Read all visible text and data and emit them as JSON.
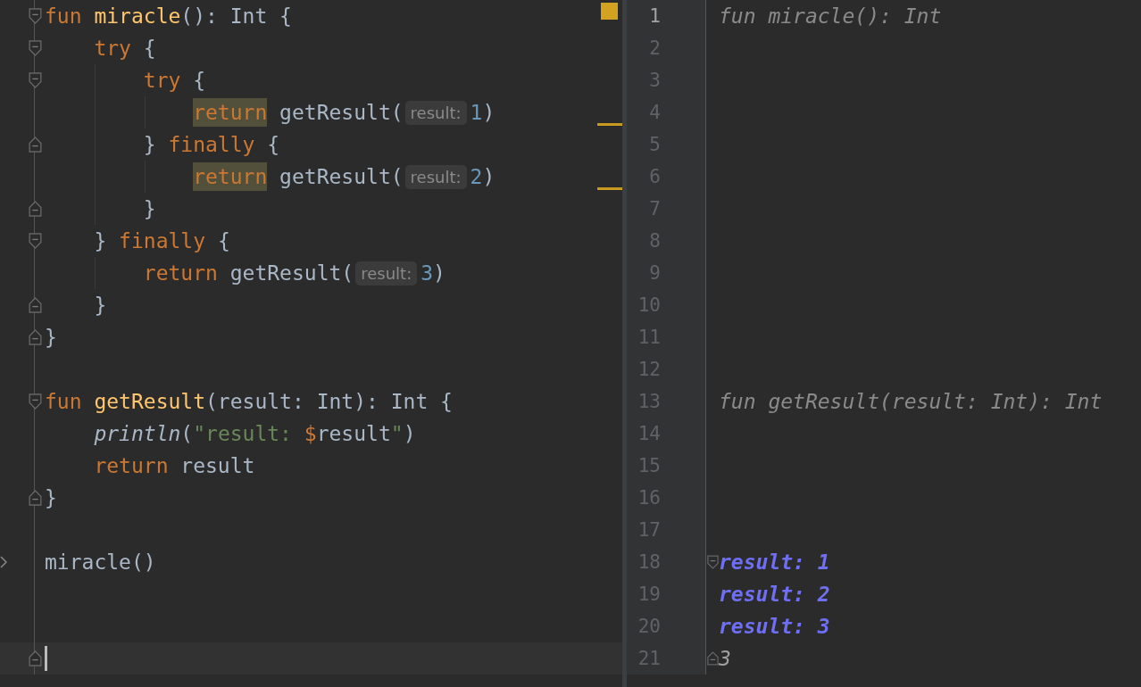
{
  "editor": {
    "lines": [
      {
        "fold_open": true,
        "fold_close": false,
        "current": false,
        "run_marker": false,
        "tokens": [
          {
            "kind": "keyword",
            "text": "fun "
          },
          {
            "kind": "decl",
            "text": "miracle"
          },
          {
            "kind": "plain",
            "text": "(): Int {"
          }
        ]
      },
      {
        "fold_open": true,
        "fold_close": false,
        "current": false,
        "run_marker": false,
        "tokens": [
          {
            "kind": "keyword",
            "text": "    try "
          },
          {
            "kind": "plain",
            "text": "{"
          }
        ]
      },
      {
        "fold_open": true,
        "fold_close": false,
        "current": false,
        "run_marker": false,
        "tokens": [
          {
            "kind": "keyword",
            "text": "        try "
          },
          {
            "kind": "plain",
            "text": "{"
          }
        ]
      },
      {
        "fold_open": false,
        "fold_close": false,
        "current": false,
        "run_marker": false,
        "tokens": [
          {
            "kind": "match",
            "text": "            return"
          },
          {
            "kind": "plain",
            "text": " getResult("
          },
          {
            "kind": "hint",
            "text": "result:"
          },
          {
            "kind": "number",
            "text": "1"
          },
          {
            "kind": "plain",
            "text": ")"
          }
        ]
      },
      {
        "fold_open": false,
        "fold_close": true,
        "current": false,
        "run_marker": false,
        "tokens": [
          {
            "kind": "plain",
            "text": "        } "
          },
          {
            "kind": "keyword",
            "text": "finally "
          },
          {
            "kind": "plain",
            "text": "{"
          }
        ]
      },
      {
        "fold_open": false,
        "fold_close": false,
        "current": false,
        "run_marker": false,
        "tokens": [
          {
            "kind": "match",
            "text": "            return"
          },
          {
            "kind": "plain",
            "text": " getResult("
          },
          {
            "kind": "hint",
            "text": "result:"
          },
          {
            "kind": "number",
            "text": "2"
          },
          {
            "kind": "plain",
            "text": ")"
          }
        ]
      },
      {
        "fold_open": false,
        "fold_close": true,
        "current": false,
        "run_marker": false,
        "tokens": [
          {
            "kind": "plain",
            "text": "        }"
          }
        ]
      },
      {
        "fold_open": true,
        "fold_close": false,
        "current": false,
        "run_marker": false,
        "tokens": [
          {
            "kind": "plain",
            "text": "    } "
          },
          {
            "kind": "keyword",
            "text": "finally "
          },
          {
            "kind": "plain",
            "text": "{"
          }
        ]
      },
      {
        "fold_open": false,
        "fold_close": false,
        "current": false,
        "run_marker": false,
        "tokens": [
          {
            "kind": "keyword",
            "text": "        return"
          },
          {
            "kind": "plain",
            "text": " getResult("
          },
          {
            "kind": "hint",
            "text": "result:"
          },
          {
            "kind": "number",
            "text": "3"
          },
          {
            "kind": "plain",
            "text": ")"
          }
        ]
      },
      {
        "fold_open": false,
        "fold_close": true,
        "current": false,
        "run_marker": false,
        "tokens": [
          {
            "kind": "plain",
            "text": "    }"
          }
        ]
      },
      {
        "fold_open": false,
        "fold_close": true,
        "current": false,
        "run_marker": false,
        "tokens": [
          {
            "kind": "plain",
            "text": "}"
          }
        ]
      },
      {
        "fold_open": false,
        "fold_close": false,
        "current": false,
        "run_marker": false
      },
      {
        "fold_open": true,
        "fold_close": false,
        "current": false,
        "run_marker": false,
        "tokens": [
          {
            "kind": "keyword",
            "text": "fun "
          },
          {
            "kind": "decl",
            "text": "getResult"
          },
          {
            "kind": "plain",
            "text": "(result: Int): Int {"
          }
        ]
      },
      {
        "fold_open": false,
        "fold_close": false,
        "current": false,
        "run_marker": false,
        "tokens": [
          {
            "kind": "call",
            "text": "    println"
          },
          {
            "kind": "plain",
            "text": "("
          },
          {
            "kind": "string",
            "text": "\"result: "
          },
          {
            "kind": "template",
            "text": "$"
          },
          {
            "kind": "plain",
            "text": "result"
          },
          {
            "kind": "string",
            "text": "\""
          },
          {
            "kind": "plain",
            "text": ")"
          }
        ]
      },
      {
        "fold_open": false,
        "fold_close": false,
        "current": false,
        "run_marker": false,
        "tokens": [
          {
            "kind": "keyword",
            "text": "    return "
          },
          {
            "kind": "plain",
            "text": "result"
          }
        ]
      },
      {
        "fold_open": false,
        "fold_close": true,
        "current": false,
        "run_marker": false,
        "tokens": [
          {
            "kind": "plain",
            "text": "}"
          }
        ]
      },
      {
        "fold_open": false,
        "fold_close": false,
        "current": false,
        "run_marker": false
      },
      {
        "fold_open": false,
        "fold_close": false,
        "current": false,
        "run_marker": true,
        "tokens": [
          {
            "kind": "plain",
            "text": "miracle()"
          }
        ]
      },
      {
        "fold_open": false,
        "fold_close": false,
        "current": false,
        "run_marker": false
      },
      {
        "fold_open": false,
        "fold_close": false,
        "current": false,
        "run_marker": false
      },
      {
        "fold_open": false,
        "fold_close": true,
        "current": true,
        "run_marker": false
      }
    ]
  },
  "results": {
    "lines": [
      {
        "number": "1",
        "current": true,
        "fold_open": false,
        "fold_close": false,
        "kind": "signature",
        "text": "fun miracle(): Int"
      },
      {
        "number": "2",
        "current": false,
        "fold_open": false,
        "fold_close": false
      },
      {
        "number": "3",
        "current": false,
        "fold_open": false,
        "fold_close": false
      },
      {
        "number": "4",
        "current": false,
        "fold_open": false,
        "fold_close": false
      },
      {
        "number": "5",
        "current": false,
        "fold_open": false,
        "fold_close": false
      },
      {
        "number": "6",
        "current": false,
        "fold_open": false,
        "fold_close": false
      },
      {
        "number": "7",
        "current": false,
        "fold_open": false,
        "fold_close": false
      },
      {
        "number": "8",
        "current": false,
        "fold_open": false,
        "fold_close": false
      },
      {
        "number": "9",
        "current": false,
        "fold_open": false,
        "fold_close": false
      },
      {
        "number": "10",
        "current": false,
        "fold_open": false,
        "fold_close": false
      },
      {
        "number": "11",
        "current": false,
        "fold_open": false,
        "fold_close": false
      },
      {
        "number": "12",
        "current": false,
        "fold_open": false,
        "fold_close": false
      },
      {
        "number": "13",
        "current": false,
        "fold_open": false,
        "fold_close": false,
        "kind": "signature",
        "text": "fun getResult(result: Int): Int"
      },
      {
        "number": "14",
        "current": false,
        "fold_open": false,
        "fold_close": false
      },
      {
        "number": "15",
        "current": false,
        "fold_open": false,
        "fold_close": false
      },
      {
        "number": "16",
        "current": false,
        "fold_open": false,
        "fold_close": false
      },
      {
        "number": "17",
        "current": false,
        "fold_open": false,
        "fold_close": false
      },
      {
        "number": "18",
        "current": false,
        "fold_open": true,
        "fold_close": false,
        "kind": "output",
        "text": "result: 1"
      },
      {
        "number": "19",
        "current": false,
        "fold_open": false,
        "fold_close": false,
        "kind": "output",
        "text": "result: 2"
      },
      {
        "number": "20",
        "current": false,
        "fold_open": false,
        "fold_close": false,
        "kind": "output",
        "text": "result: 3"
      },
      {
        "number": "21",
        "current": false,
        "fold_open": false,
        "fold_close": true,
        "kind": "value",
        "text": "3"
      }
    ]
  }
}
